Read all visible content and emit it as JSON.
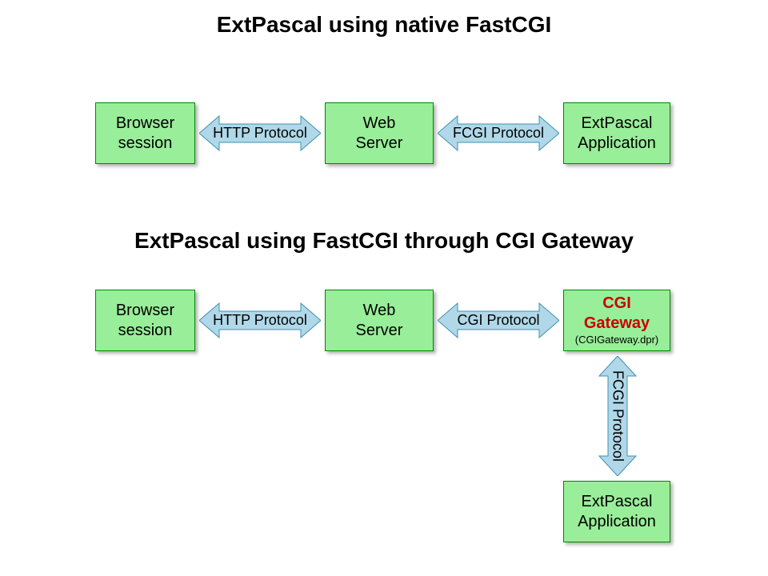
{
  "title1": "ExtPascal using native FastCGI",
  "title2": "ExtPascal using FastCGI through CGI Gateway",
  "row1": {
    "box1_l1": "Browser",
    "box1_l2": "session",
    "arrow1": "HTTP Protocol",
    "box2_l1": "Web",
    "box2_l2": "Server",
    "arrow2": "FCGI Protocol",
    "box3_l1": "ExtPascal",
    "box3_l2": "Application"
  },
  "row2": {
    "box1_l1": "Browser",
    "box1_l2": "session",
    "arrow1": "HTTP Protocol",
    "box2_l1": "Web",
    "box2_l2": "Server",
    "arrow2": "CGI Protocol",
    "box3_l1": "CGI",
    "box3_l2": "Gateway",
    "box3_sub": "(CGIGateway.dpr)",
    "arrow3": "FCGI Protocol",
    "box4_l1": "ExtPascal",
    "box4_l2": "Application"
  },
  "colors": {
    "boxFill": "#99ee99",
    "boxBorder": "#008800",
    "arrowFill": "#b0d8e8",
    "arrowBorder": "#4090b0",
    "highlight": "#cc0000"
  }
}
